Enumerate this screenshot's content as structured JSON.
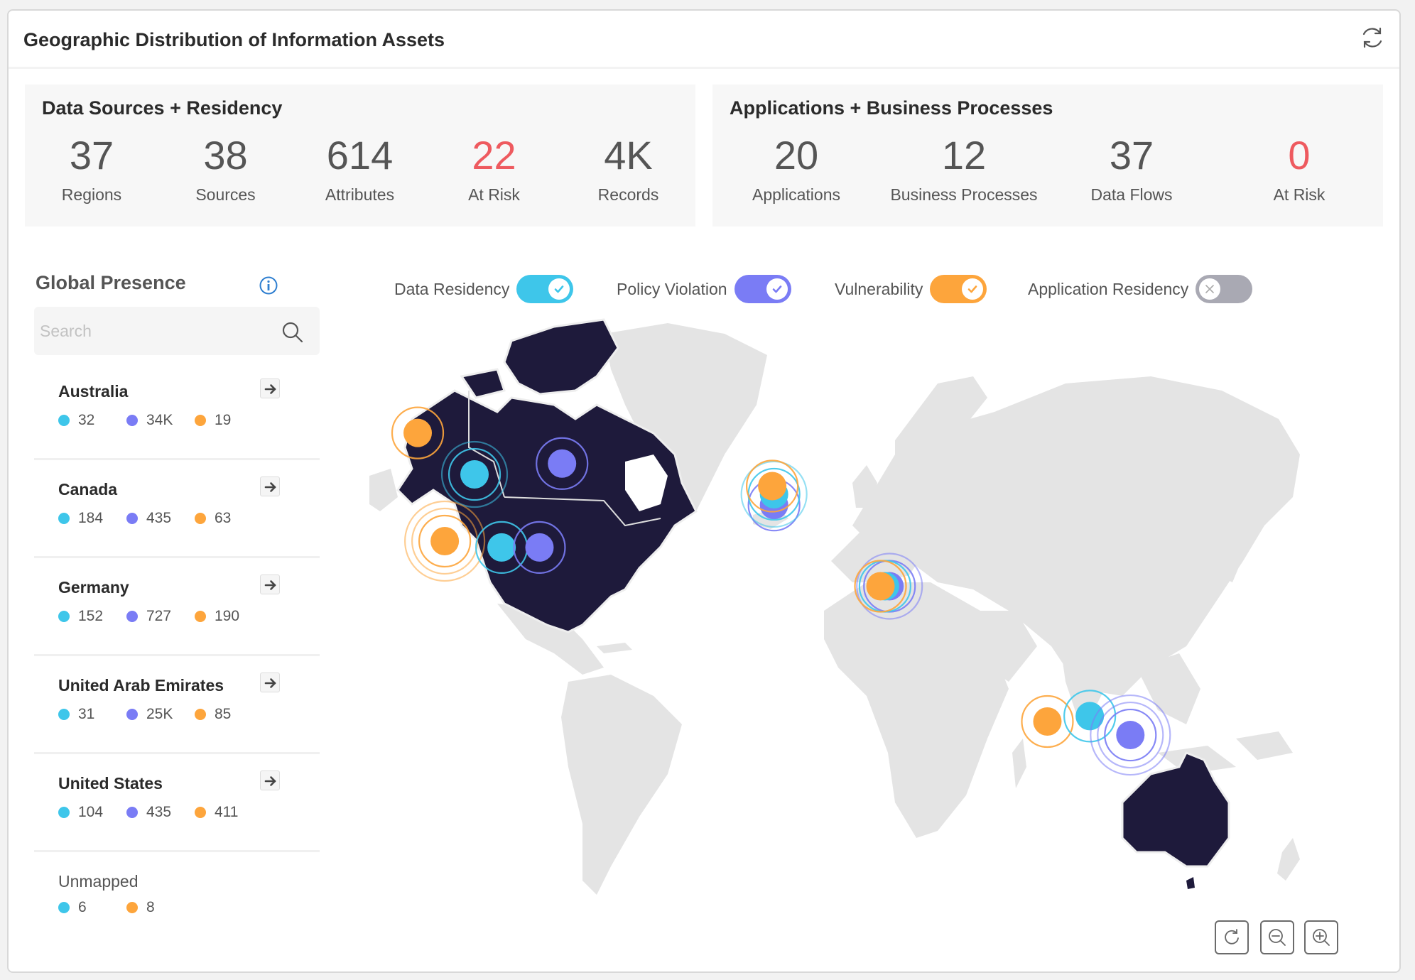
{
  "panel": {
    "title": "Geographic Distribution of Information Assets"
  },
  "colors": {
    "data_residency": "#3ec6ea",
    "policy_violation": "#7a7cf5",
    "vulnerability": "#fda53c",
    "application_residency": "#a9a9b3",
    "risk": "#ee5a5f",
    "highlight_land": "#1e1a3b",
    "land": "#e4e4e4"
  },
  "data_sources": {
    "title": "Data Sources + Residency",
    "stats": [
      {
        "value": "37",
        "label": "Regions",
        "risk": false
      },
      {
        "value": "38",
        "label": "Sources",
        "risk": false
      },
      {
        "value": "614",
        "label": "Attributes",
        "risk": false
      },
      {
        "value": "22",
        "label": "At Risk",
        "risk": true
      },
      {
        "value": "4K",
        "label": "Records",
        "risk": false
      }
    ]
  },
  "applications": {
    "title": "Applications + Business Processes",
    "stats": [
      {
        "value": "20",
        "label": "Applications",
        "risk": false
      },
      {
        "value": "12",
        "label": "Business Processes",
        "risk": false
      },
      {
        "value": "37",
        "label": "Data Flows",
        "risk": false
      },
      {
        "value": "0",
        "label": "At Risk",
        "risk": true
      }
    ]
  },
  "global_presence": {
    "title": "Global Presence",
    "info_icon": "info-icon",
    "search": {
      "placeholder": "Search",
      "value": ""
    },
    "countries": [
      {
        "name": "Australia",
        "residency": "32",
        "violation": "34K",
        "vulnerability": "19"
      },
      {
        "name": "Canada",
        "residency": "184",
        "violation": "435",
        "vulnerability": "63"
      },
      {
        "name": "Germany",
        "residency": "152",
        "violation": "727",
        "vulnerability": "190"
      },
      {
        "name": "United Arab Emirates",
        "residency": "31",
        "violation": "25K",
        "vulnerability": "85"
      },
      {
        "name": "United States",
        "residency": "104",
        "violation": "435",
        "vulnerability": "411"
      }
    ],
    "unmapped": {
      "name": "Unmapped",
      "residency": "6",
      "vulnerability": "8"
    }
  },
  "toggles": [
    {
      "label": "Data Residency",
      "on": true,
      "color": "#3ec6ea"
    },
    {
      "label": "Policy Violation",
      "on": true,
      "color": "#7a7cf5"
    },
    {
      "label": "Vulnerability",
      "on": true,
      "color": "#fda53c"
    },
    {
      "label": "Application Residency",
      "on": false,
      "color": "#a9a9b3"
    }
  ],
  "map": {
    "highlighted_countries": [
      "Canada",
      "United States",
      "Australia"
    ],
    "markers": [
      {
        "country": "Canada",
        "type": "vulnerability",
        "rings": 1
      },
      {
        "country": "Canada",
        "type": "data_residency",
        "rings": 2
      },
      {
        "country": "Canada",
        "type": "policy_violation",
        "rings": 1
      },
      {
        "country": "United States",
        "type": "vulnerability",
        "rings": 3
      },
      {
        "country": "United States",
        "type": "data_residency",
        "rings": 1
      },
      {
        "country": "United States",
        "type": "policy_violation",
        "rings": 1
      },
      {
        "country": "Germany",
        "type": "policy_violation",
        "rings": 1
      },
      {
        "country": "Germany",
        "type": "data_residency",
        "rings": 2
      },
      {
        "country": "Germany",
        "type": "vulnerability",
        "rings": 1
      },
      {
        "country": "United Arab Emirates",
        "type": "policy_violation",
        "rings": 2
      },
      {
        "country": "United Arab Emirates",
        "type": "data_residency",
        "rings": 1
      },
      {
        "country": "United Arab Emirates",
        "type": "vulnerability",
        "rings": 1
      },
      {
        "country": "Australia",
        "type": "vulnerability",
        "rings": 1
      },
      {
        "country": "Australia",
        "type": "data_residency",
        "rings": 1
      },
      {
        "country": "Australia",
        "type": "policy_violation",
        "rings": 3
      }
    ],
    "controls": [
      "reset",
      "zoom-out",
      "zoom-in"
    ]
  }
}
